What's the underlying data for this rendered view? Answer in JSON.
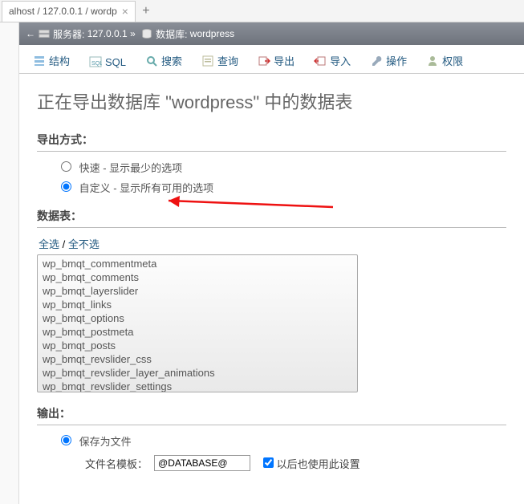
{
  "browser": {
    "tab_title": "alhost / 127.0.0.1 / wordp"
  },
  "breadcrumb": {
    "arrow": "←",
    "server_label": "服务器:",
    "server_value": "127.0.0.1",
    "sep": "»",
    "db_label": "数据库:",
    "db_value": "wordpress"
  },
  "nav": {
    "structure": "结构",
    "sql": "SQL",
    "search": "搜索",
    "query": "查询",
    "export": "导出",
    "import": "导入",
    "operations": "操作",
    "privileges": "权限"
  },
  "page_title": "正在导出数据库 \"wordpress\" 中的数据表",
  "export_method": {
    "heading": "导出方式：",
    "quick": "快速 - 显示最少的选项",
    "custom": "自定义 - 显示所有可用的选项"
  },
  "tables": {
    "heading": "数据表：",
    "select_all": "全选",
    "unselect_all": "全不选",
    "items": [
      "wp_bmqt_commentmeta",
      "wp_bmqt_comments",
      "wp_bmqt_layerslider",
      "wp_bmqt_links",
      "wp_bmqt_options",
      "wp_bmqt_postmeta",
      "wp_bmqt_posts",
      "wp_bmqt_revslider_css",
      "wp_bmqt_revslider_layer_animations",
      "wp_bmqt_revslider_settings"
    ]
  },
  "output": {
    "heading": "输出：",
    "save_to_file": "保存为文件",
    "filename_template_label": "文件名模板：",
    "filename_template_value": "@DATABASE@",
    "use_later": "以后也使用此设置"
  }
}
